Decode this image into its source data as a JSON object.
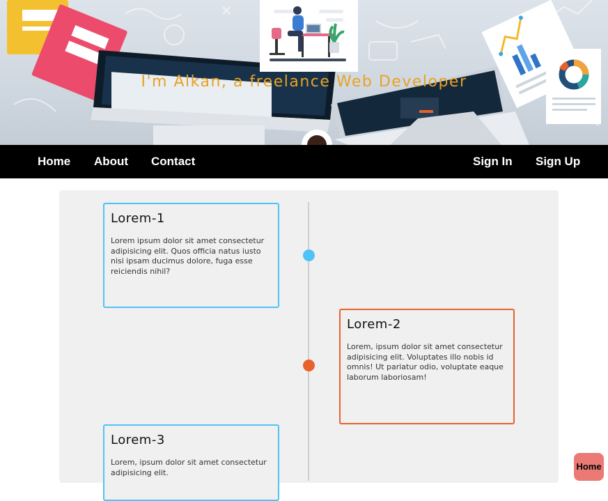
{
  "hero": {
    "title": "I'm Alkan, a freelance Web Developer"
  },
  "nav": {
    "left_items": [
      "Home",
      "About",
      "Contact"
    ],
    "right_items": [
      "Sign In",
      "Sign Up"
    ]
  },
  "timeline": {
    "items": [
      {
        "title": "Lorem-1",
        "text": "Lorem ipsum dolor sit amet consectetur adipisicing elit. Quos officia natus iusto nisi ipsam ducimus dolore, fuga esse reiciendis nihil?",
        "side": "left",
        "color": "#4fc3f7"
      },
      {
        "title": "Lorem-2",
        "text": "Lorem, ipsum dolor sit amet consectetur adipisicing elit. Voluptates illo nobis id omnis! Ut pariatur odio, voluptate eaque laborum laboriosam!",
        "side": "right",
        "color": "#e8612c"
      },
      {
        "title": "Lorem-3",
        "text": "Lorem, ipsum dolor sit amet consectetur adipisicing elit.",
        "side": "left",
        "color": "#4fc3f7"
      }
    ]
  },
  "fab": {
    "label": "Home"
  },
  "colors": {
    "accent_title": "#e8a224",
    "nav_bg": "#000000",
    "panel_bg": "#f0f0f0",
    "blue": "#4fc3f7",
    "orange": "#e8612c",
    "fab_bg": "#ec7a74"
  }
}
